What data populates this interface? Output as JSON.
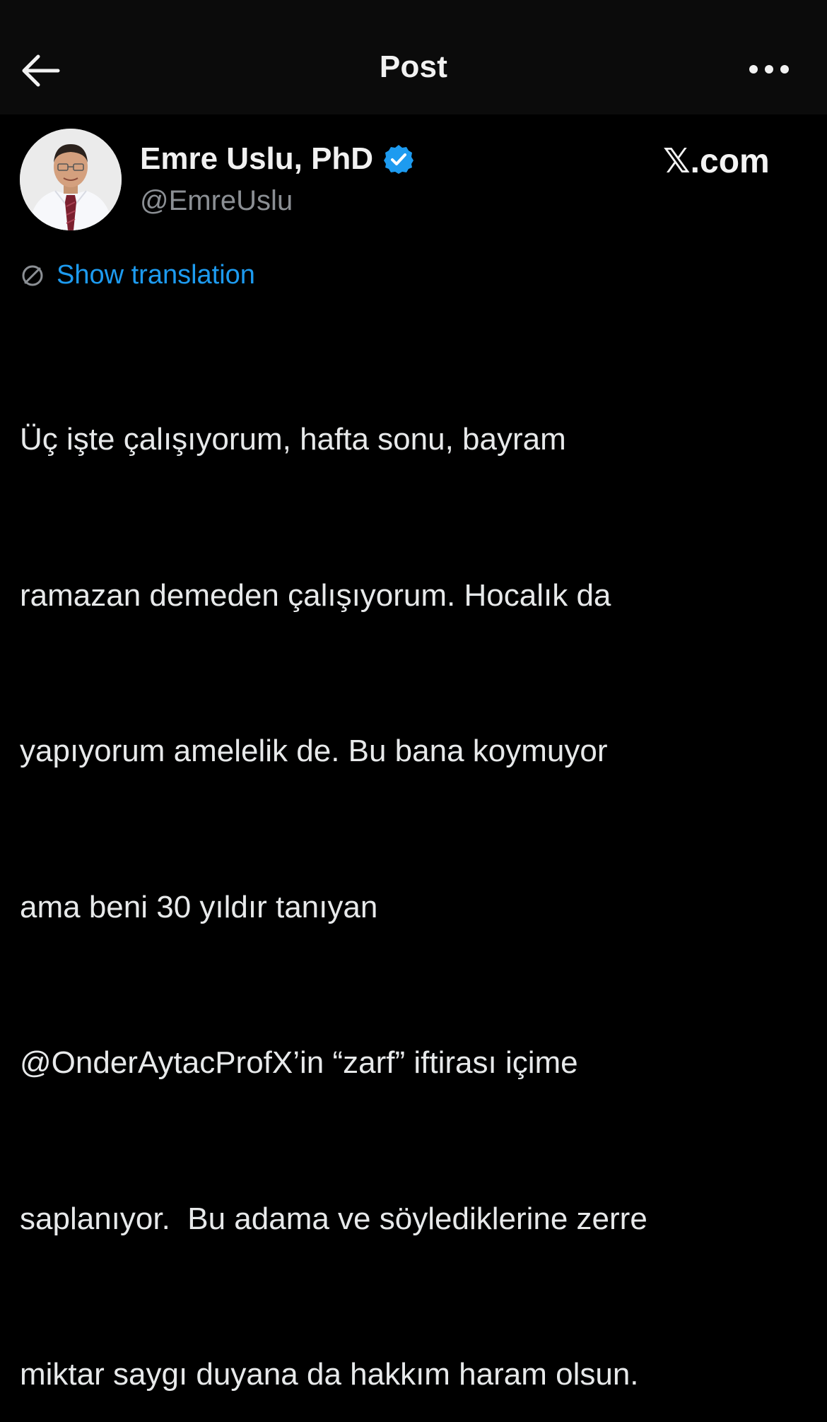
{
  "header": {
    "title": "Post"
  },
  "author": {
    "name": "Emre Uslu, PhD",
    "handle": "@EmreUslu",
    "verified": true
  },
  "watermark": {
    "text": "𝕏.com"
  },
  "translation": {
    "label": "Show translation"
  },
  "post": {
    "lines": [
      "Üç işte çalışıyorum, hafta sonu, bayram",
      "ramazan demeden çalışıyorum. Hocalık da",
      "yapıyorum amelelik de. Bu bana koymuyor",
      "ama beni 30 yıldır tanıyan",
      "@OnderAytacProfX’in “zarf” iftirası içime",
      "saplanıyor.  Bu adama ve söylediklerine zerre",
      "miktar saygı duyana da hakkım haram olsun."
    ]
  },
  "colors": {
    "background": "#000000",
    "header_background": "#0b0b0b",
    "text": "#e7e9ea",
    "secondary_text": "#8b8f94",
    "accent_blue": "#1d9bf0"
  }
}
